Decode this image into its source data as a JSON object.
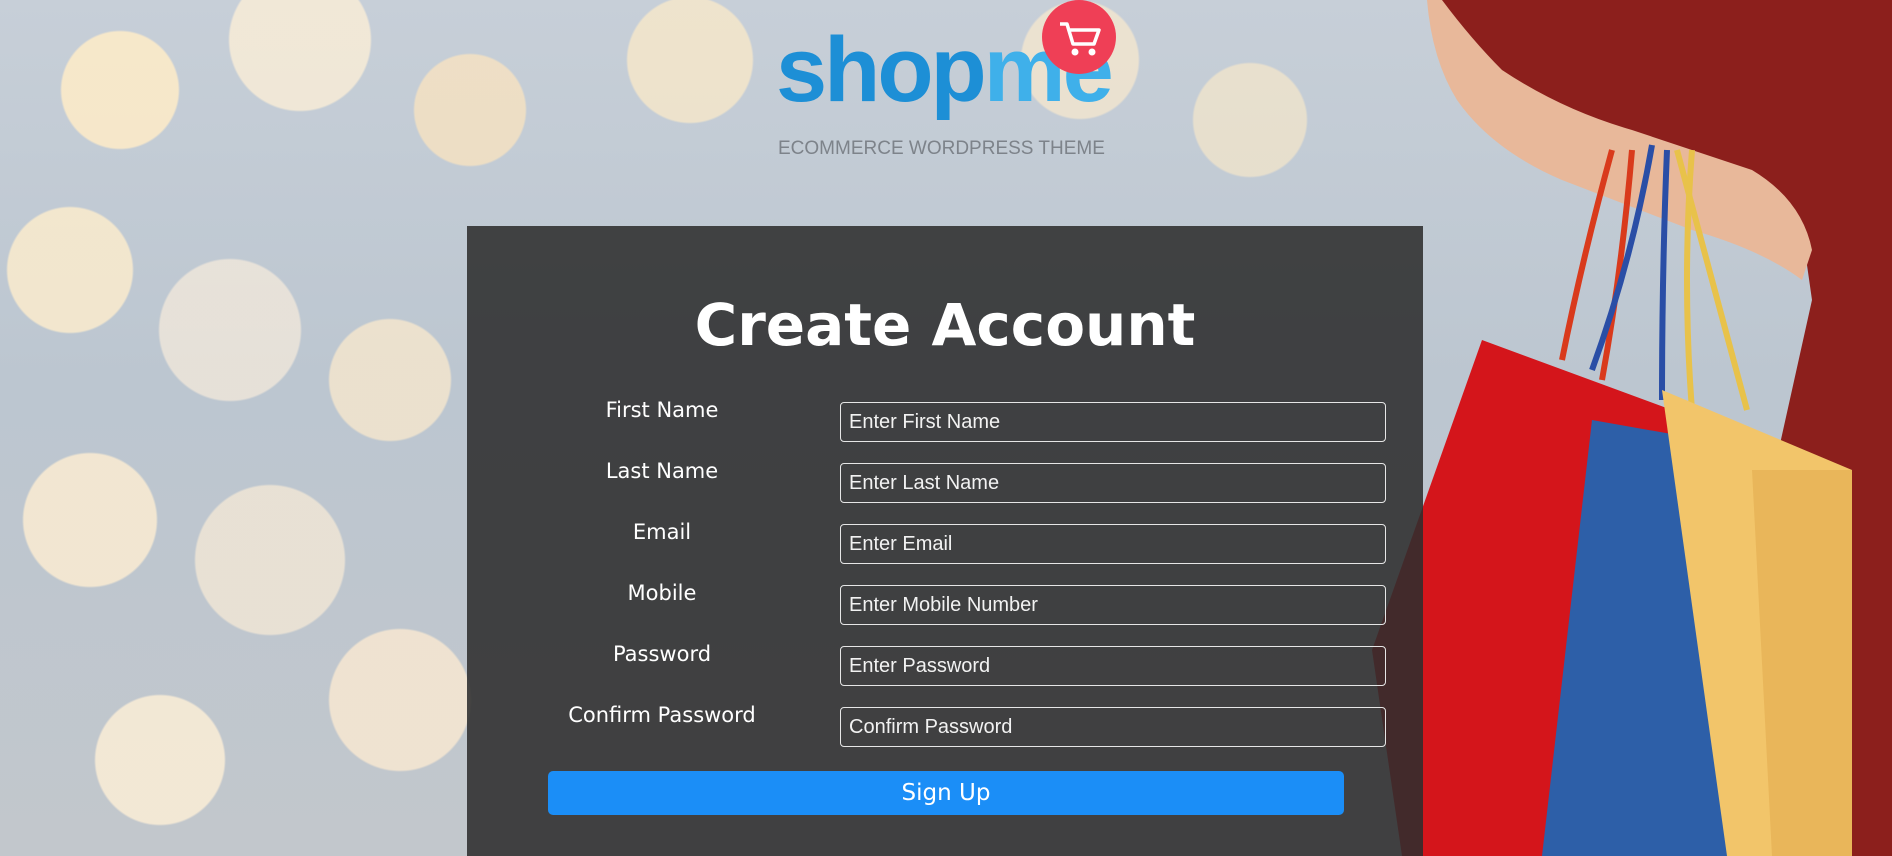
{
  "logo": {
    "word_primary": "shop",
    "word_secondary": "me",
    "tagline": "ECOMMERCE WORDPRESS THEME",
    "icon": "cart-icon"
  },
  "form": {
    "title": "Create Account",
    "fields": [
      {
        "label": "First Name",
        "placeholder": "Enter First Name",
        "value": ""
      },
      {
        "label": "Last Name",
        "placeholder": "Enter Last Name",
        "value": ""
      },
      {
        "label": "Email",
        "placeholder": "Enter Email",
        "value": ""
      },
      {
        "label": "Mobile",
        "placeholder": "Enter Mobile Number",
        "value": ""
      },
      {
        "label": "Password",
        "placeholder": "Enter Password",
        "value": ""
      },
      {
        "label": "Confirm Password",
        "placeholder": "Confirm Password",
        "value": ""
      }
    ],
    "submit_label": "Sign Up"
  },
  "colors": {
    "brand_blue": "#1d8fd6",
    "brand_light_blue": "#3fb0ea",
    "cart_bubble": "#ef3f56",
    "button": "#1b8ef7",
    "card_bg": "#2d2d2d"
  }
}
